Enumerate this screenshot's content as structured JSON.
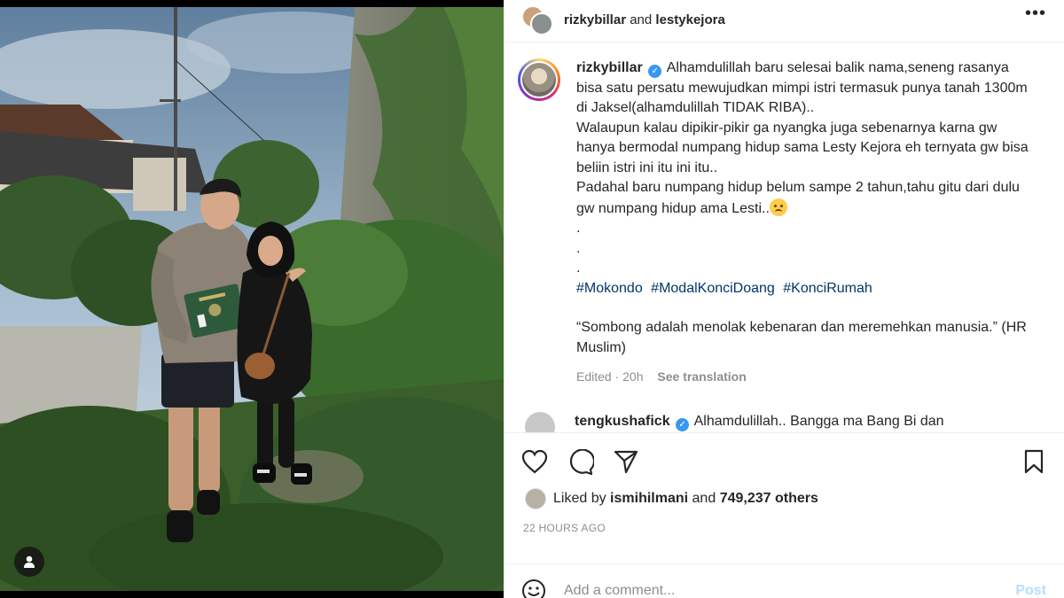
{
  "post": {
    "header": {
      "usernames": "rizkybillar",
      "and_text": "and",
      "coauthor": "lestykejora",
      "more": "•••"
    },
    "caption": {
      "username": "rizkybillar",
      "text": "Alhamdulillah baru selesai balik nama,seneng rasanya bisa satu persatu mewujudkan mimpi istri termasuk punya tanah 1300m di Jaksel(alhamdulillah TIDAK RIBA)..\nWalaupun kalau dipikir-pikir ga nyangka juga sebenarnya karna gw hanya bermodal numpang hidup sama Lesty Kejora eh ternyata gw bisa beliin istri ini itu ini itu..\nPadahal baru numpang hidup belum sampe 2 tahun,tahu gitu dari dulu gw numpang hidup ama Lesti..",
      "dots": [
        ".",
        ".",
        "."
      ],
      "hashtags": [
        "#Mokondo",
        "#ModalKonciDoang",
        "#KonciRumah"
      ],
      "quote": "“Sombong adalah menolak kebenaran dan meremehkan manusia.” (HR Muslim)",
      "edited": "Edited · 20h",
      "see_translation": "See translation"
    },
    "comment": {
      "username": "tengkushafick",
      "text": "Alhamdulillah.. Bangga ma Bang Bi dan"
    },
    "likes": {
      "prefix": "Liked by",
      "user": "ismihilmani",
      "and_text": "and",
      "count": "749,237 others"
    },
    "timestamp": "22 HOURS AGO",
    "add_comment": {
      "placeholder": "Add a comment...",
      "post_label": "Post"
    }
  },
  "icons": {
    "like": "heart-icon",
    "comment": "comment-icon",
    "share": "share-icon",
    "save": "bookmark-icon",
    "emoji": "emoji-icon",
    "user_tag": "user-tag-icon",
    "verified": "verified-badge-icon"
  },
  "colors": {
    "link": "#00376b",
    "verified": "#3897f0",
    "muted": "#8e8e8e",
    "post_disabled": "#b2dffc"
  }
}
